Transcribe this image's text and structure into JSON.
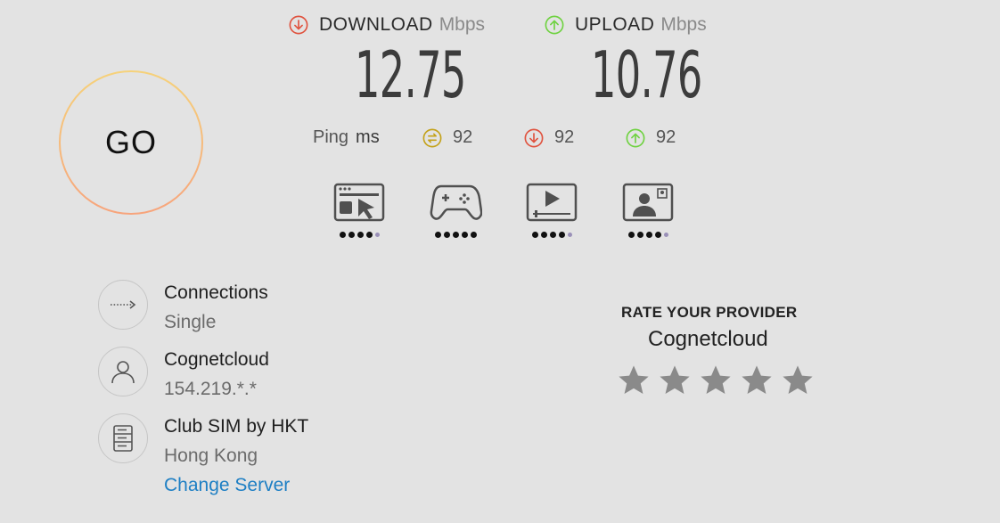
{
  "go_button": {
    "label": "GO"
  },
  "download": {
    "label": "DOWNLOAD",
    "unit": "Mbps",
    "value": "12.75"
  },
  "upload": {
    "label": "UPLOAD",
    "unit": "Mbps",
    "value": "10.76"
  },
  "ping": {
    "label": "Ping",
    "unit": "ms",
    "idle": "92",
    "download": "92",
    "upload": "92"
  },
  "activities": [
    {
      "icon": "web-browsing-icon",
      "rating": 4,
      "max": 5
    },
    {
      "icon": "gaming-icon",
      "rating": 5,
      "max": 5
    },
    {
      "icon": "video-streaming-icon",
      "rating": 4,
      "max": 5
    },
    {
      "icon": "video-chat-icon",
      "rating": 4,
      "max": 5
    }
  ],
  "connections": {
    "title": "Connections",
    "value": "Single"
  },
  "isp": {
    "name": "Cognetcloud",
    "ip": "154.219.*.*"
  },
  "server": {
    "name": "Club SIM by HKT",
    "location": "Hong Kong",
    "change_link": "Change Server"
  },
  "rate_provider": {
    "title": "RATE YOUR PROVIDER",
    "provider": "Cognetcloud",
    "stars": 5
  },
  "colors": {
    "download_accent": "#e0533f",
    "upload_accent": "#6fd241",
    "ping_idle_accent": "#c4a21a",
    "link": "#1e7fc4",
    "star": "#8a8a8a"
  }
}
